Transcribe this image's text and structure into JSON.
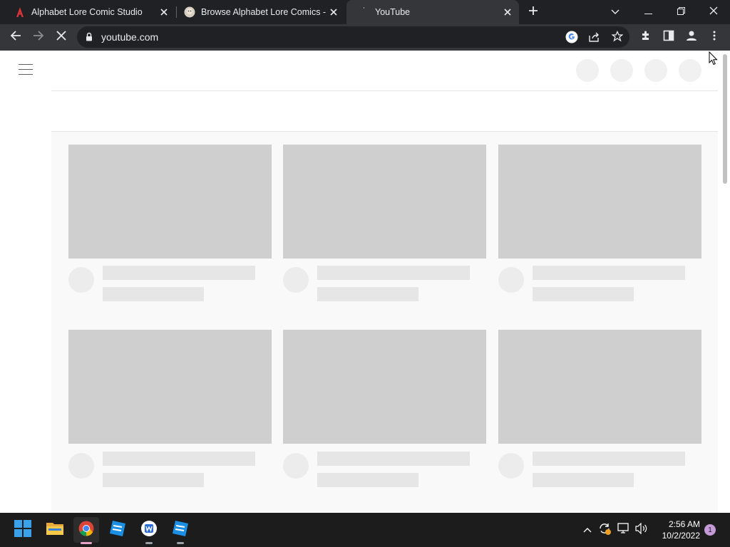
{
  "browser": {
    "tabs": [
      {
        "title": "Alphabet Lore Comic Studio",
        "icon": "alphabet-lore-a-icon",
        "active": false
      },
      {
        "title": "Browse Alphabet Lore Comics - C",
        "icon": "comic-avatar-icon",
        "active": false
      },
      {
        "title": "YouTube",
        "icon": "loading-spinner-icon",
        "active": true
      }
    ],
    "new_tab_icon": "plus-icon",
    "window_controls": [
      "tab-search-icon",
      "minimize-icon",
      "restore-icon",
      "close-icon"
    ],
    "toolbar": {
      "back_icon": "arrow-left-icon",
      "forward_icon": "arrow-right-icon",
      "stop_icon": "stop-loading-icon",
      "lock_icon": "lock-icon",
      "url": "youtube.com",
      "right_icons": [
        "google-lens-icon",
        "share-icon",
        "bookmark-star-icon",
        "extensions-icon",
        "side-panel-icon",
        "profile-icon",
        "more-menu-icon"
      ]
    }
  },
  "page": {
    "state": "loading-skeleton",
    "header_placeholder_circles": 4,
    "grid": {
      "rows": 2,
      "columns": 3
    },
    "colors": {
      "thumbnail_placeholder": "#cfcfcf",
      "text_placeholder": "#e6e6e6",
      "avatar_placeholder": "#f1f1f1",
      "content_background": "#f9f9f9"
    }
  },
  "taskbar": {
    "apps": [
      {
        "name": "start-windows-icon"
      },
      {
        "name": "file-explorer-icon"
      },
      {
        "name": "chrome-icon",
        "active": true
      },
      {
        "name": "roblox-studio-icon"
      },
      {
        "name": "wordpad-icon"
      },
      {
        "name": "roblox-studio-icon-2"
      }
    ],
    "tray_icons": [
      "chevron-up-icon",
      "sync-warning-icon",
      "network-icon",
      "volume-icon"
    ],
    "time": "2:56 AM",
    "date": "10/2/2022",
    "notification_count": "1"
  }
}
